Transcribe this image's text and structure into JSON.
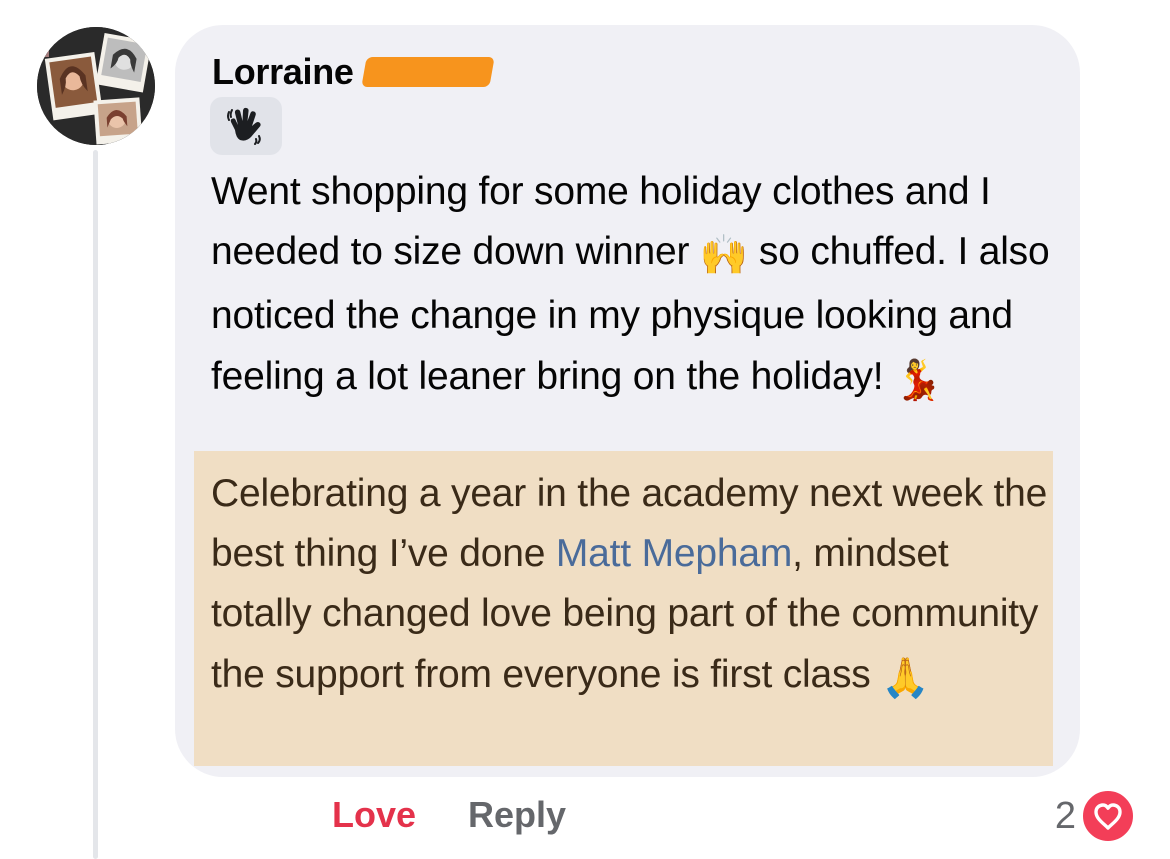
{
  "comment": {
    "author": "Lorraine",
    "badge_icon": "waving-hand-icon",
    "paragraph1": {
      "line_a": "Went shopping for some holiday clothes and I needed to size down winner ",
      "emoji_a": "🙌",
      "line_b": " so chuffed. I also noticed the change in my physique looking and feeling a lot leaner bring on the holiday! ",
      "emoji_b": "💃"
    },
    "paragraph2": {
      "text_a": "Celebrating a year in the academy next week the best thing I’ve done ",
      "mention": "Matt Mepham",
      "text_b": ", mindset totally changed love being part of the community the support from everyone is first class ",
      "emoji_c": "🙏"
    }
  },
  "actions": {
    "love_label": "Love",
    "reply_label": "Reply"
  },
  "reactions": {
    "count": "2",
    "icon": "heart-icon"
  },
  "colors": {
    "bubble": "#f0f0f5",
    "highlight": "#f0dec4",
    "mention": "#4a6b9a",
    "love": "#e4324b",
    "heart": "#f33e58",
    "redaction": "#f7941d"
  }
}
